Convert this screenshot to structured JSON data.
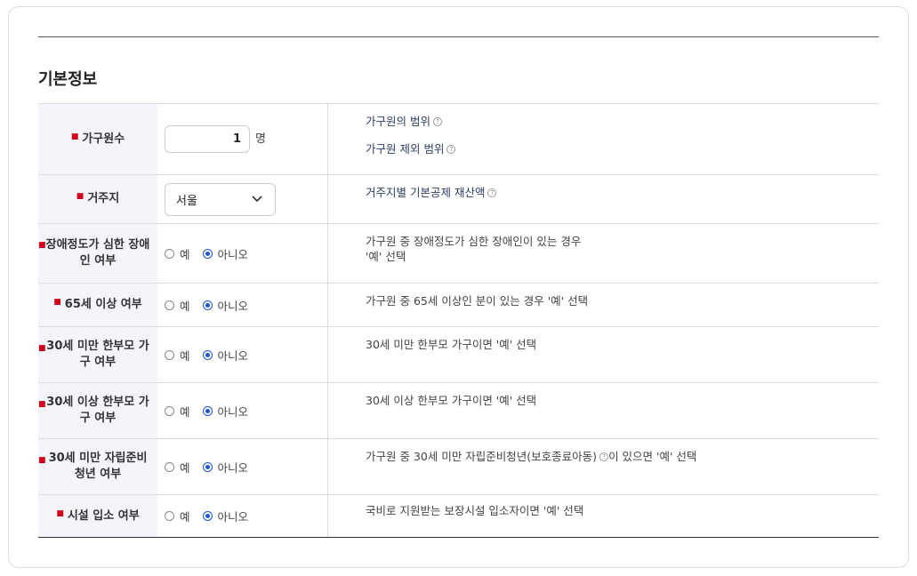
{
  "section_title": "기본정보",
  "rows": [
    {
      "label": "가구원수",
      "value": "1",
      "unit": "명",
      "desc": [
        "가구원의 범위",
        "가구원 제외 범위"
      ]
    },
    {
      "label": "거주지",
      "select_value": "서울",
      "desc": [
        "거주지별 기본공제 재산액"
      ]
    },
    {
      "label": "장애정도가 심한 장애인 여부",
      "desc": [
        "가구원 중 장애정도가 심한 장애인이 있는 경우",
        "'예' 선택"
      ]
    },
    {
      "label": "65세 이상 여부",
      "desc": [
        "가구원 중 65세 이상인 분이 있는 경우 '예' 선택"
      ]
    },
    {
      "label": "30세 미만 한부모 가구 여부",
      "desc": [
        "30세 미만 한부모 가구이면 '예' 선택"
      ]
    },
    {
      "label": "30세 이상 한부모 가구 여부",
      "desc": [
        "30세 이상 한부모 가구이면 '예' 선택"
      ]
    },
    {
      "label": "30세 미만 자립준비 청년 여부",
      "desc": [
        "가구원 중 30세 미만 자립준비청년(보호종료아동)",
        "이 있으면 '예' 선택"
      ]
    },
    {
      "label": "시설 입소 여부",
      "desc": [
        "국비로 지원받는 보장시설 입소자이면 '예' 선택"
      ]
    }
  ],
  "radio": {
    "yes": "예",
    "no": "아니오",
    "selected": "아니오"
  },
  "icons": {
    "help": "help-icon",
    "select_arrow": "chevron-down-icon"
  },
  "colors": {
    "required": "#d0021b",
    "label_bg": "#f3f5fa",
    "radio_checked": "#1a56db"
  }
}
